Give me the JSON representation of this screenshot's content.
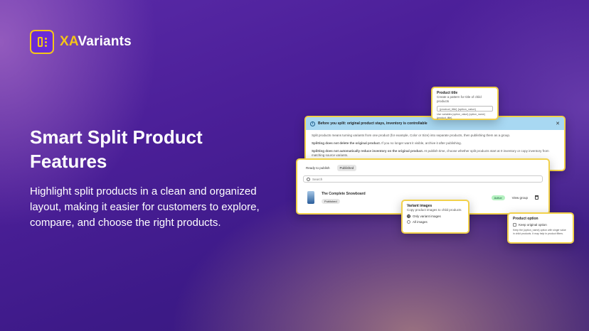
{
  "brand": {
    "name_prefix": "XA",
    "name_suffix": "Variants"
  },
  "hero": {
    "title": "Smart Split Product Features",
    "description": "Highlight split products in a clean and organized layout, making it easier for customers to explore, compare, and choose the right products."
  },
  "banner": {
    "title": "Before you split: original product stays, inventory is controllable",
    "line1": "Split products means turning variants from one product (for example, Color or Size) into separate products, then publishing them as a group.",
    "line2_bold": "Splitting does not delete the original product.",
    "line2_rest": " If you no longer want it visible, archive it after publishing.",
    "line3_bold": "Splitting does not automatically reduce inventory on the original product.",
    "line3_rest": " At publish time, choose whether split products start at 0 inventory or copy inventory from matching source variants."
  },
  "product_title_card": {
    "title": "Product title",
    "hint": "Create a pattern for title of child products",
    "input_value": "{product_title} {option_value}",
    "vars": "Use variables {option_value} {option_name} {product_title}"
  },
  "list": {
    "tabs": [
      "Ready to publish",
      "Published"
    ],
    "search_placeholder": "Search",
    "product_name": "The Complete Snowboard",
    "published_badge": "Published",
    "active_badge": "Active",
    "view_group": "View group"
  },
  "variant_images_card": {
    "title": "Variant images",
    "hint": "Copy product images to child products",
    "options": [
      "Only variant images",
      "All images"
    ]
  },
  "product_option_card": {
    "title": "Product option",
    "option": "Keep original option",
    "hint": "Keep the {option_name} option with single value in child products. It may help in product filters."
  }
}
